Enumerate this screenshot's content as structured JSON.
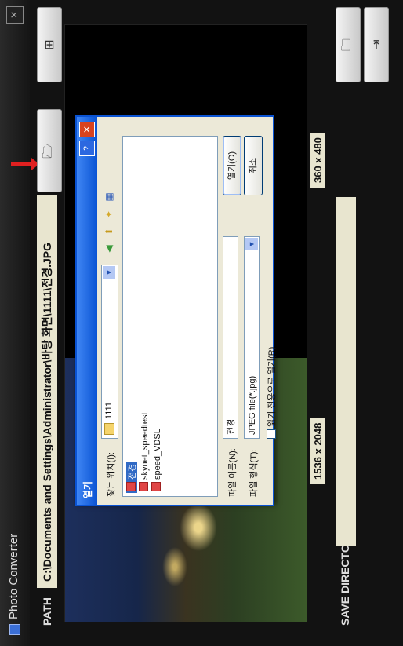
{
  "app": {
    "title": "Photo Converter"
  },
  "path": {
    "label": "PATH",
    "value": "C:\\Documents and Settings\\Administrator\\바탕 화면\\1111\\전경.JPG"
  },
  "sizes": {
    "left": "1536 x 2048",
    "right": "360 x 480"
  },
  "save": {
    "label": "SAVE DIRECTORY",
    "value": ""
  },
  "dialog": {
    "title": "열기",
    "help": "?",
    "lookin_label": "찾는 위치(I):",
    "lookin_value": "1111",
    "files": [
      "전경",
      "skynet_speedtest",
      "speed_VDSL"
    ],
    "filename_label": "파일 이름(N):",
    "filename_value": "전경",
    "filetype_label": "파일 형식(T):",
    "filetype_value": "JPEG file(*.jpg)",
    "readonly_label": "읽기 전용으로 열기(R)",
    "open_label": "열기(O)",
    "cancel_label": "취소"
  }
}
